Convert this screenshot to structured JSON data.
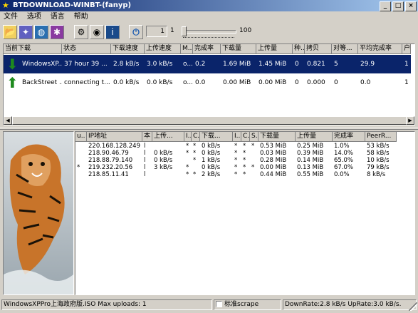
{
  "window": {
    "title": "BTDOWNLOAD-WINBT-(fanyp)",
    "buttons": [
      "_",
      "□",
      "×"
    ]
  },
  "menu": [
    "文件",
    "选项",
    "语言",
    "帮助"
  ],
  "toolbar": {
    "icons": [
      "open-folder-icon",
      "new-torrent-icon",
      "globe-icon",
      "color-palette-icon",
      "settings-icon",
      "disk-icon",
      "info-icon",
      "power-icon"
    ],
    "uploads_value": "1",
    "uploads_label": "1",
    "slider_level": 0,
    "slider_max": "100"
  },
  "torrents": {
    "columns": [
      "当前下载",
      "状态",
      "下载速度",
      "上传速度",
      "M..",
      "完成率",
      "下载量",
      "上传量",
      "种..",
      "拷贝",
      "对等...",
      "平均完成率",
      "户"
    ],
    "rows": [
      {
        "cells": [
          "WindowsXP...",
          "37 hour 39 ...",
          "2.8 kB/s",
          "3.0 kB/s",
          "o...",
          "0.2",
          "1.69 MiB",
          "1.45 MiB",
          "0",
          "0.821",
          "5",
          "29.9",
          "1"
        ],
        "selected": true
      },
      {
        "cells": [
          "BackStreet ...",
          "connecting t...",
          "0.0 kB/s",
          "0.0 kB/s",
          "o...",
          "0.0",
          "0.00 MiB",
          "0.00 MiB",
          "0",
          "0.000",
          "0",
          "0.0",
          "1"
        ],
        "selected": false
      }
    ]
  },
  "peers": {
    "columns": [
      "u..",
      "IP地址",
      "本",
      "上传...",
      "I..",
      "C..",
      "下载...",
      "I..",
      "C..",
      "S..",
      "下载量",
      "上传量",
      "完成率",
      "PeerR..."
    ],
    "rows": [
      [
        "",
        "220.168.128.249",
        "l",
        "",
        "*",
        "*",
        "0 kB/s",
        "*",
        "*",
        "*",
        "0.53 MiB",
        "0.25 MiB",
        "1.0%",
        "53 kB/s"
      ],
      [
        "",
        "218.90.46.79",
        "l",
        "0 kB/s",
        "*",
        "*",
        "0 kB/s",
        "*",
        "*",
        "",
        "0.03 MiB",
        "0.39 MiB",
        "14.0%",
        "58 kB/s"
      ],
      [
        "",
        "218.88.79.140",
        "l",
        "0 kB/s",
        "",
        "*",
        "1 kB/s",
        "*",
        "*",
        "",
        "0.28 MiB",
        "0.14 MiB",
        "65.0%",
        "10 kB/s"
      ],
      [
        "*",
        "219.232.20.56",
        "l",
        "3 kB/s",
        "*",
        "",
        "0 kB/s",
        "*",
        "*",
        "*",
        "0.00 MiB",
        "0.13 MiB",
        "67.0%",
        "79 kB/s"
      ],
      [
        "",
        "218.85.11.41",
        "l",
        "",
        "*",
        "*",
        "2 kB/s",
        "*",
        "*",
        "",
        "0.44 MiB",
        "0.55 MiB",
        "0.0%",
        "8 kB/s"
      ]
    ]
  },
  "status": {
    "left": "WindowsXPPro上海政府版.ISO  Max uploads: 1",
    "scrape_label": "标准scrape",
    "rates": "DownRate:2.8 kB/s UpRate:3.0 kB/s."
  },
  "colors": {
    "title_start": "#0a246a",
    "title_end": "#a6caf0",
    "selection": "#0a246a"
  }
}
